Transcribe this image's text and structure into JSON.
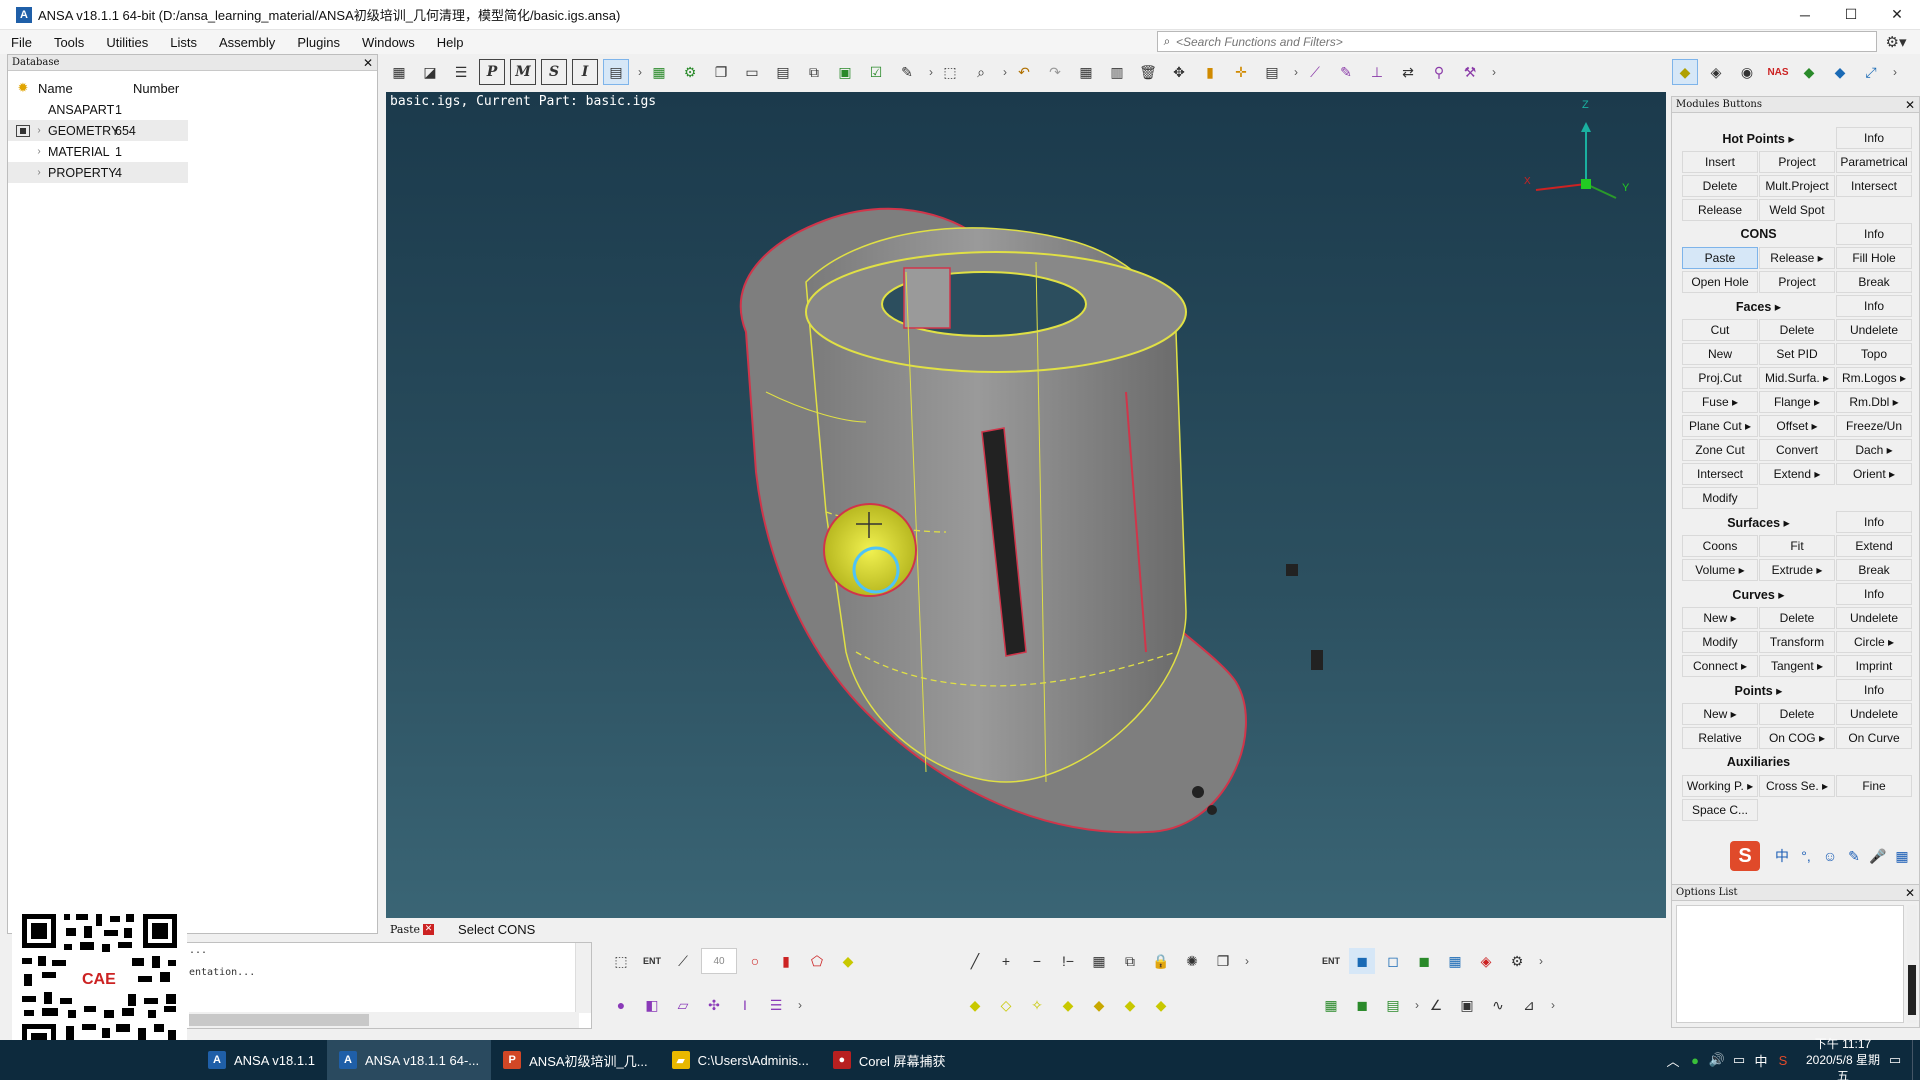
{
  "window": {
    "title": "ANSA v18.1.1 64-bit (D:/ansa_learning_material/ANSA初级培训_几何清理，模型简化/basic.igs.ansa)",
    "minimize": "─",
    "maximize": "☐",
    "close": "✕"
  },
  "menu": [
    "File",
    "Tools",
    "Utilities",
    "Lists",
    "Assembly",
    "Plugins",
    "Windows",
    "Help"
  ],
  "search": {
    "placeholder": "<Search Functions and Filters>"
  },
  "database": {
    "title": "Database",
    "col_name": "Name",
    "col_number": "Number",
    "rows": [
      {
        "name": "ANSAPART",
        "number": "1"
      },
      {
        "name": "GEOMETRY",
        "number": "654"
      },
      {
        "name": "MATERIAL",
        "number": "1"
      },
      {
        "name": "PROPERTY",
        "number": "4"
      }
    ]
  },
  "viewport": {
    "caption": "basic.igs,  Current Part: basic.igs",
    "axis_z": "Z",
    "axis_y": "Y",
    "axis_x": "X"
  },
  "console": {
    "line1": "...",
    "line2": "entation..."
  },
  "status": {
    "tab": "Paste",
    "message": "Select CONS",
    "spin_value": "40"
  },
  "modules": {
    "title": "Modules Buttons",
    "rows": [
      [
        "Hot Points ▸",
        "",
        "Info"
      ],
      [
        "Insert",
        "Project",
        "Parametrical"
      ],
      [
        "Delete",
        "Mult.Project",
        "Intersect"
      ],
      [
        "Release",
        "Weld Spot",
        ""
      ],
      [
        "CONS",
        "",
        "Info"
      ],
      [
        "Paste",
        "Release ▸",
        "Fill Hole"
      ],
      [
        "Open Hole",
        "Project",
        "Break"
      ],
      [
        "Faces ▸",
        "",
        "Info"
      ],
      [
        "Cut",
        "Delete",
        "Undelete"
      ],
      [
        "New",
        "Set PID",
        "Topo"
      ],
      [
        "Proj.Cut",
        "Mid.Surfa. ▸",
        "Rm.Logos ▸"
      ],
      [
        "Fuse ▸",
        "Flange ▸",
        "Rm.Dbl ▸"
      ],
      [
        "Plane Cut ▸",
        "Offset ▸",
        "Freeze/Un"
      ],
      [
        "Zone Cut",
        "Convert",
        "Dach ▸"
      ],
      [
        "Intersect",
        "Extend ▸",
        "Orient ▸"
      ],
      [
        "Modify",
        "",
        ""
      ],
      [
        "Surfaces ▸",
        "",
        "Info"
      ],
      [
        "Coons",
        "Fit",
        "Extend"
      ],
      [
        "Volume ▸",
        "Extrude ▸",
        "Break"
      ],
      [
        "Curves ▸",
        "",
        "Info"
      ],
      [
        "New ▸",
        "Delete",
        "Undelete"
      ],
      [
        "Modify",
        "Transform",
        "Circle ▸"
      ],
      [
        "Connect ▸",
        "Tangent ▸",
        "Imprint"
      ],
      [
        "Points ▸",
        "",
        "Info"
      ],
      [
        "New ▸",
        "Delete",
        "Undelete"
      ],
      [
        "Relative",
        "On COG ▸",
        "On Curve"
      ],
      [
        "Auxiliaries",
        "",
        ""
      ],
      [
        "Working P. ▸",
        "Cross Se. ▸",
        "Fine"
      ],
      [
        "Space C...",
        "",
        ""
      ]
    ]
  },
  "options": {
    "title": "Options List"
  },
  "taskbar": {
    "tasks": [
      {
        "label": "ANSA v18.1.1",
        "icon": "A",
        "color": "#1f5fa8"
      },
      {
        "label": "ANSA v18.1.1 64-...",
        "icon": "A",
        "color": "#1f5fa8"
      },
      {
        "label": "ANSA初级培训_几...",
        "icon": "P",
        "color": "#d24726"
      },
      {
        "label": "C:\\Users\\Adminis...",
        "icon": "▰",
        "color": "#e8b800"
      },
      {
        "label": "Corel 屏幕捕获",
        "icon": "●",
        "color": "#b82020"
      }
    ],
    "time": "下午 11:17",
    "date": "2020/5/8 星期五",
    "ime": "中"
  },
  "qr": {
    "logo": "CAE"
  },
  "colors": {
    "accent": "#1f5fa8",
    "viewport_top": "#1b3a4c",
    "viewport_bottom": "#3a6575",
    "taskbar": "#0d2a3d"
  }
}
